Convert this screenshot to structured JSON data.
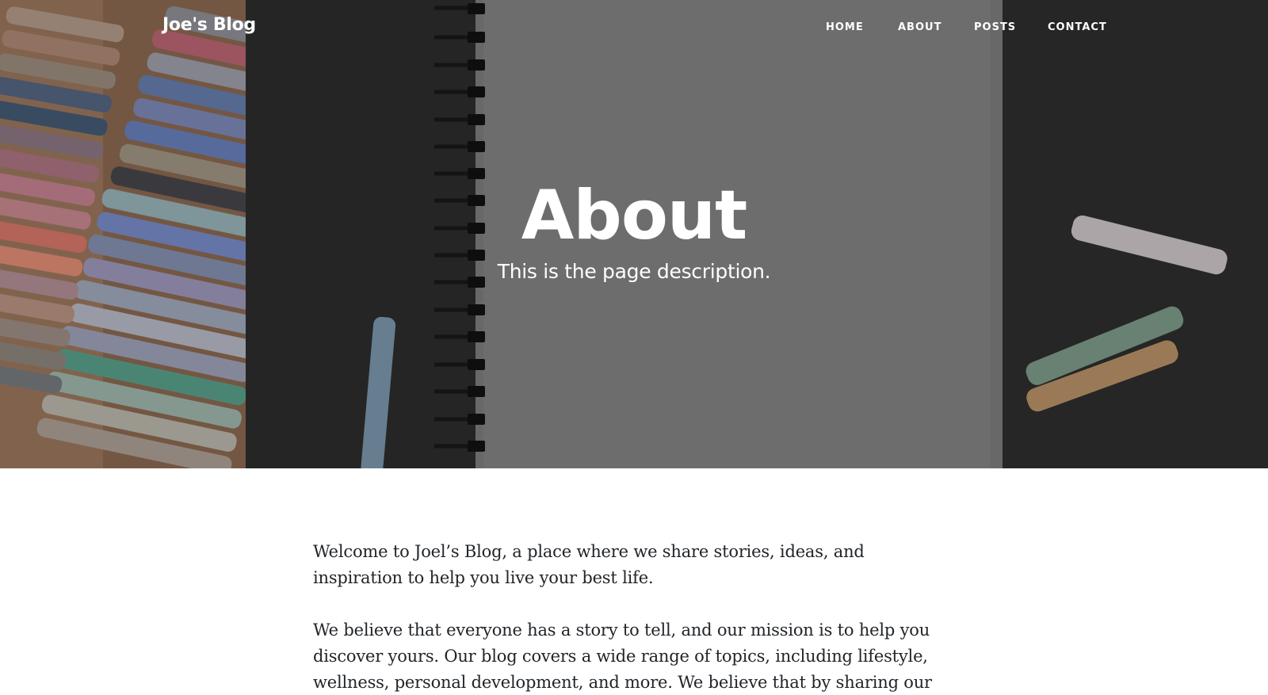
{
  "nav": {
    "brand": "Joe's Blog",
    "links": [
      {
        "label": "HOME"
      },
      {
        "label": "ABOUT"
      },
      {
        "label": "POSTS"
      },
      {
        "label": "CONTACT"
      }
    ]
  },
  "hero": {
    "title": "About",
    "subtitle": "This is the page description."
  },
  "content": {
    "paragraphs": [
      "Welcome to Joel’s Blog, a place where we share stories, ideas, and inspiration to help you live your best life.",
      "We believe that everyone has a story to tell, and our mission is to help you discover yours. Our blog covers a wide range of topics, including lifestyle, wellness, personal development, and more. We believe that by sharing our"
    ]
  },
  "colors": {
    "text": "#212529",
    "hero_text": "#ffffff"
  }
}
